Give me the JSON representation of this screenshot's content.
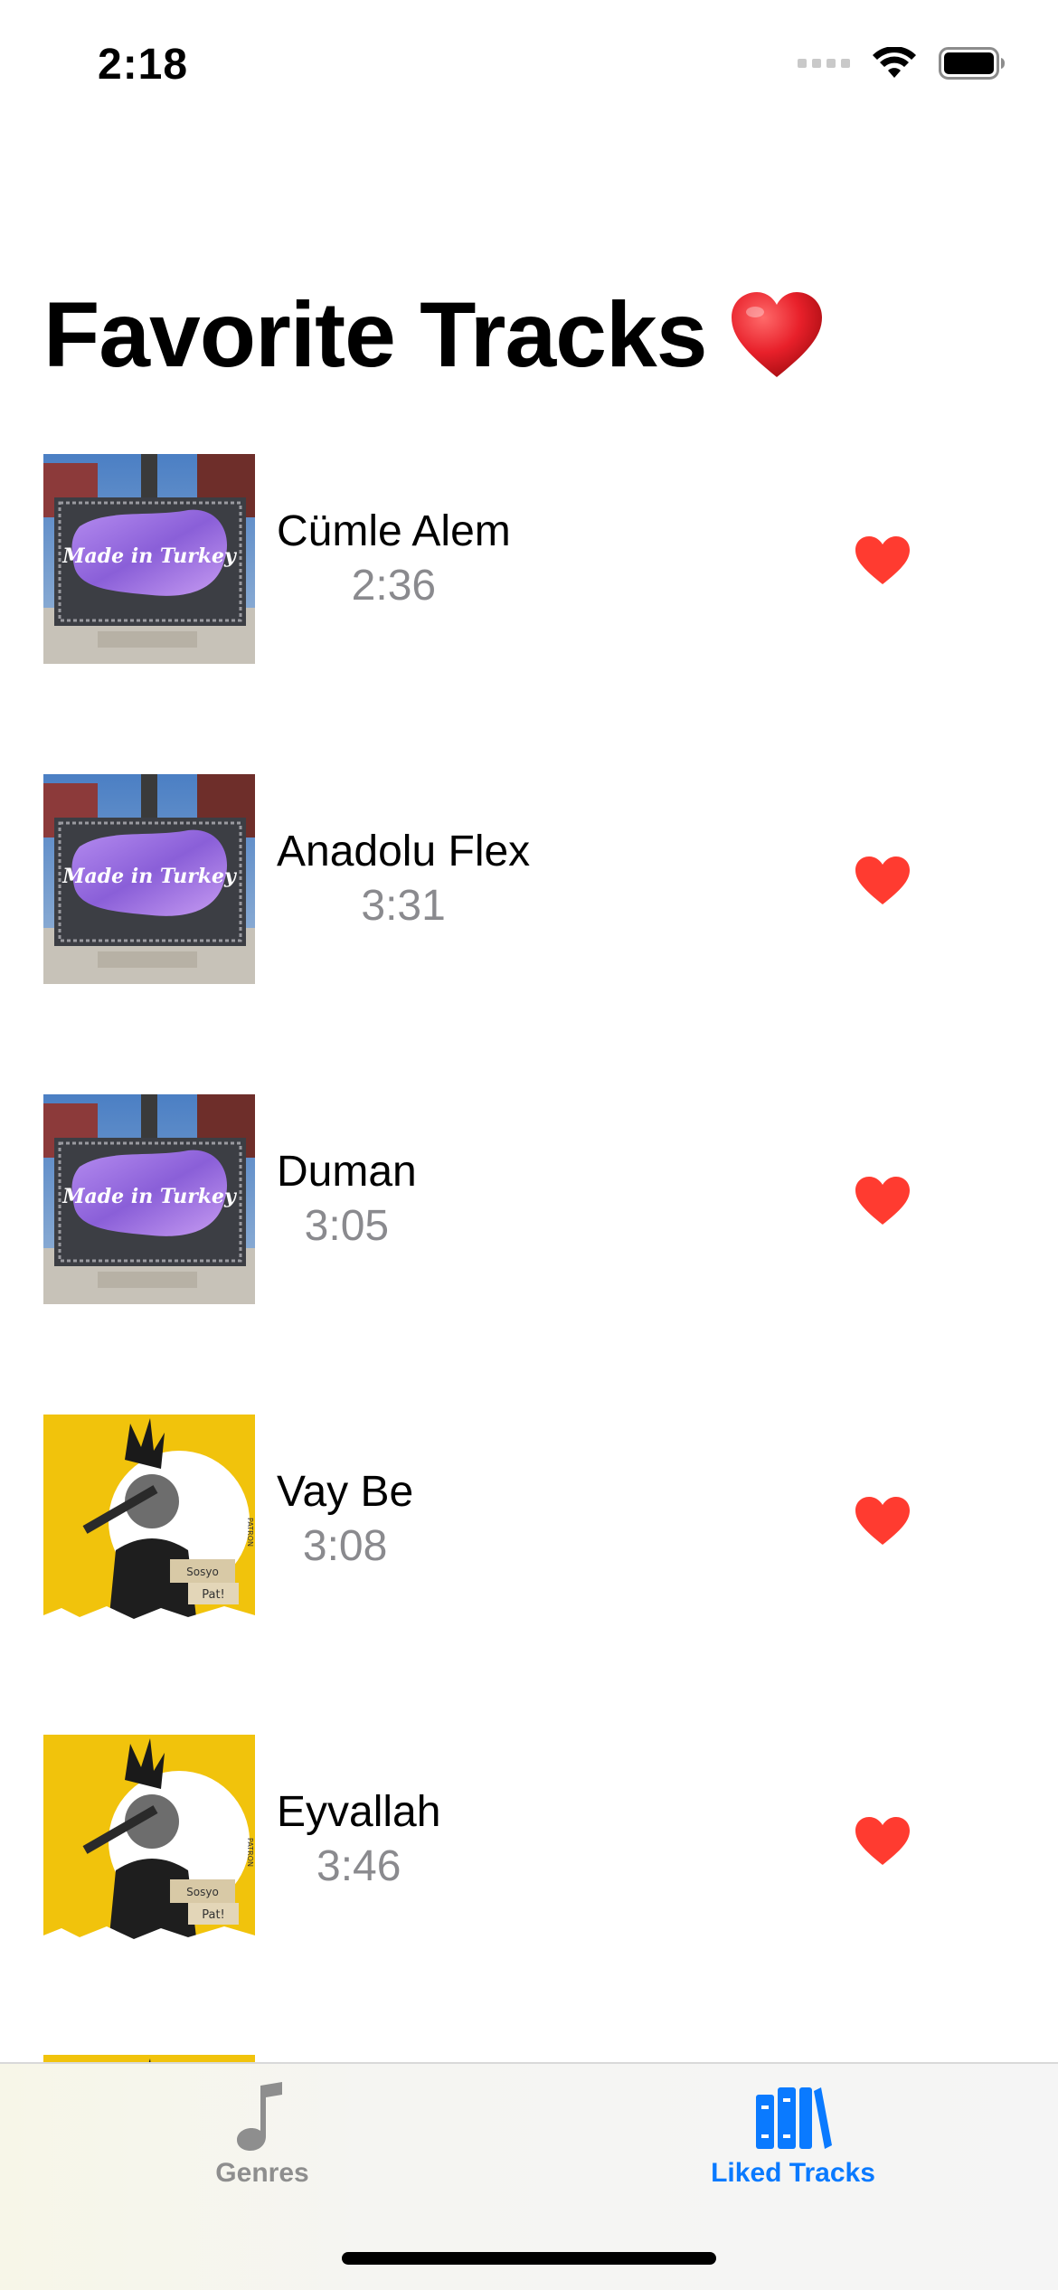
{
  "status_bar": {
    "time": "2:18",
    "icons": [
      "cellular-signal-icon",
      "wifi-icon",
      "battery-icon"
    ]
  },
  "page": {
    "title": "Favorite Tracks",
    "title_emoji_icon": "red-heart-emoji-icon"
  },
  "tracks": [
    {
      "title": "Cümle Alem",
      "duration": "2:36",
      "artwork_icon": "album-cover-made-in-turkey-icon",
      "liked": true
    },
    {
      "title": "Anadolu Flex",
      "duration": "3:31",
      "artwork_icon": "album-cover-made-in-turkey-icon",
      "liked": true
    },
    {
      "title": "Duman",
      "duration": "3:05",
      "artwork_icon": "album-cover-made-in-turkey-icon",
      "liked": true
    },
    {
      "title": "Vay Be",
      "duration": "3:08",
      "artwork_icon": "album-cover-patron-icon",
      "liked": true
    },
    {
      "title": "Eyvallah",
      "duration": "3:46",
      "artwork_icon": "album-cover-patron-icon",
      "liked": true
    }
  ],
  "tab_bar": {
    "tabs": [
      {
        "label": "Genres",
        "icon": "music-note-icon",
        "selected": false
      },
      {
        "label": "Liked Tracks",
        "icon": "library-books-icon",
        "selected": true
      }
    ]
  },
  "colors": {
    "accent": "#0a7aff",
    "heart": "#ff3b30",
    "secondary_text": "#8a8a8e",
    "inactive_tab": "#8e8e8e"
  }
}
